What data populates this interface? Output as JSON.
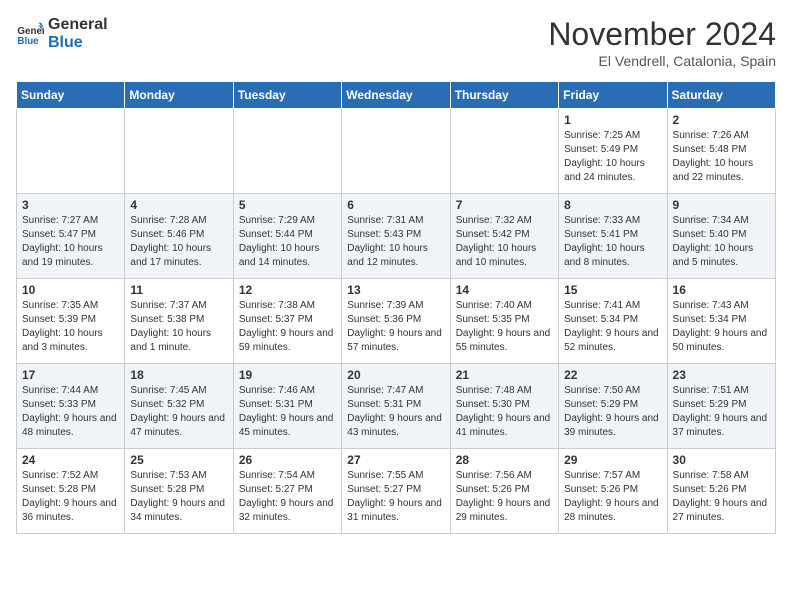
{
  "logo": {
    "line1": "General",
    "line2": "Blue"
  },
  "title": "November 2024",
  "location": "El Vendrell, Catalonia, Spain",
  "days_of_week": [
    "Sunday",
    "Monday",
    "Tuesday",
    "Wednesday",
    "Thursday",
    "Friday",
    "Saturday"
  ],
  "weeks": [
    [
      {
        "day": "",
        "sunrise": "",
        "sunset": "",
        "daylight": ""
      },
      {
        "day": "",
        "sunrise": "",
        "sunset": "",
        "daylight": ""
      },
      {
        "day": "",
        "sunrise": "",
        "sunset": "",
        "daylight": ""
      },
      {
        "day": "",
        "sunrise": "",
        "sunset": "",
        "daylight": ""
      },
      {
        "day": "",
        "sunrise": "",
        "sunset": "",
        "daylight": ""
      },
      {
        "day": "1",
        "sunrise": "Sunrise: 7:25 AM",
        "sunset": "Sunset: 5:49 PM",
        "daylight": "Daylight: 10 hours and 24 minutes."
      },
      {
        "day": "2",
        "sunrise": "Sunrise: 7:26 AM",
        "sunset": "Sunset: 5:48 PM",
        "daylight": "Daylight: 10 hours and 22 minutes."
      }
    ],
    [
      {
        "day": "3",
        "sunrise": "Sunrise: 7:27 AM",
        "sunset": "Sunset: 5:47 PM",
        "daylight": "Daylight: 10 hours and 19 minutes."
      },
      {
        "day": "4",
        "sunrise": "Sunrise: 7:28 AM",
        "sunset": "Sunset: 5:46 PM",
        "daylight": "Daylight: 10 hours and 17 minutes."
      },
      {
        "day": "5",
        "sunrise": "Sunrise: 7:29 AM",
        "sunset": "Sunset: 5:44 PM",
        "daylight": "Daylight: 10 hours and 14 minutes."
      },
      {
        "day": "6",
        "sunrise": "Sunrise: 7:31 AM",
        "sunset": "Sunset: 5:43 PM",
        "daylight": "Daylight: 10 hours and 12 minutes."
      },
      {
        "day": "7",
        "sunrise": "Sunrise: 7:32 AM",
        "sunset": "Sunset: 5:42 PM",
        "daylight": "Daylight: 10 hours and 10 minutes."
      },
      {
        "day": "8",
        "sunrise": "Sunrise: 7:33 AM",
        "sunset": "Sunset: 5:41 PM",
        "daylight": "Daylight: 10 hours and 8 minutes."
      },
      {
        "day": "9",
        "sunrise": "Sunrise: 7:34 AM",
        "sunset": "Sunset: 5:40 PM",
        "daylight": "Daylight: 10 hours and 5 minutes."
      }
    ],
    [
      {
        "day": "10",
        "sunrise": "Sunrise: 7:35 AM",
        "sunset": "Sunset: 5:39 PM",
        "daylight": "Daylight: 10 hours and 3 minutes."
      },
      {
        "day": "11",
        "sunrise": "Sunrise: 7:37 AM",
        "sunset": "Sunset: 5:38 PM",
        "daylight": "Daylight: 10 hours and 1 minute."
      },
      {
        "day": "12",
        "sunrise": "Sunrise: 7:38 AM",
        "sunset": "Sunset: 5:37 PM",
        "daylight": "Daylight: 9 hours and 59 minutes."
      },
      {
        "day": "13",
        "sunrise": "Sunrise: 7:39 AM",
        "sunset": "Sunset: 5:36 PM",
        "daylight": "Daylight: 9 hours and 57 minutes."
      },
      {
        "day": "14",
        "sunrise": "Sunrise: 7:40 AM",
        "sunset": "Sunset: 5:35 PM",
        "daylight": "Daylight: 9 hours and 55 minutes."
      },
      {
        "day": "15",
        "sunrise": "Sunrise: 7:41 AM",
        "sunset": "Sunset: 5:34 PM",
        "daylight": "Daylight: 9 hours and 52 minutes."
      },
      {
        "day": "16",
        "sunrise": "Sunrise: 7:43 AM",
        "sunset": "Sunset: 5:34 PM",
        "daylight": "Daylight: 9 hours and 50 minutes."
      }
    ],
    [
      {
        "day": "17",
        "sunrise": "Sunrise: 7:44 AM",
        "sunset": "Sunset: 5:33 PM",
        "daylight": "Daylight: 9 hours and 48 minutes."
      },
      {
        "day": "18",
        "sunrise": "Sunrise: 7:45 AM",
        "sunset": "Sunset: 5:32 PM",
        "daylight": "Daylight: 9 hours and 47 minutes."
      },
      {
        "day": "19",
        "sunrise": "Sunrise: 7:46 AM",
        "sunset": "Sunset: 5:31 PM",
        "daylight": "Daylight: 9 hours and 45 minutes."
      },
      {
        "day": "20",
        "sunrise": "Sunrise: 7:47 AM",
        "sunset": "Sunset: 5:31 PM",
        "daylight": "Daylight: 9 hours and 43 minutes."
      },
      {
        "day": "21",
        "sunrise": "Sunrise: 7:48 AM",
        "sunset": "Sunset: 5:30 PM",
        "daylight": "Daylight: 9 hours and 41 minutes."
      },
      {
        "day": "22",
        "sunrise": "Sunrise: 7:50 AM",
        "sunset": "Sunset: 5:29 PM",
        "daylight": "Daylight: 9 hours and 39 minutes."
      },
      {
        "day": "23",
        "sunrise": "Sunrise: 7:51 AM",
        "sunset": "Sunset: 5:29 PM",
        "daylight": "Daylight: 9 hours and 37 minutes."
      }
    ],
    [
      {
        "day": "24",
        "sunrise": "Sunrise: 7:52 AM",
        "sunset": "Sunset: 5:28 PM",
        "daylight": "Daylight: 9 hours and 36 minutes."
      },
      {
        "day": "25",
        "sunrise": "Sunrise: 7:53 AM",
        "sunset": "Sunset: 5:28 PM",
        "daylight": "Daylight: 9 hours and 34 minutes."
      },
      {
        "day": "26",
        "sunrise": "Sunrise: 7:54 AM",
        "sunset": "Sunset: 5:27 PM",
        "daylight": "Daylight: 9 hours and 32 minutes."
      },
      {
        "day": "27",
        "sunrise": "Sunrise: 7:55 AM",
        "sunset": "Sunset: 5:27 PM",
        "daylight": "Daylight: 9 hours and 31 minutes."
      },
      {
        "day": "28",
        "sunrise": "Sunrise: 7:56 AM",
        "sunset": "Sunset: 5:26 PM",
        "daylight": "Daylight: 9 hours and 29 minutes."
      },
      {
        "day": "29",
        "sunrise": "Sunrise: 7:57 AM",
        "sunset": "Sunset: 5:26 PM",
        "daylight": "Daylight: 9 hours and 28 minutes."
      },
      {
        "day": "30",
        "sunrise": "Sunrise: 7:58 AM",
        "sunset": "Sunset: 5:26 PM",
        "daylight": "Daylight: 9 hours and 27 minutes."
      }
    ]
  ]
}
